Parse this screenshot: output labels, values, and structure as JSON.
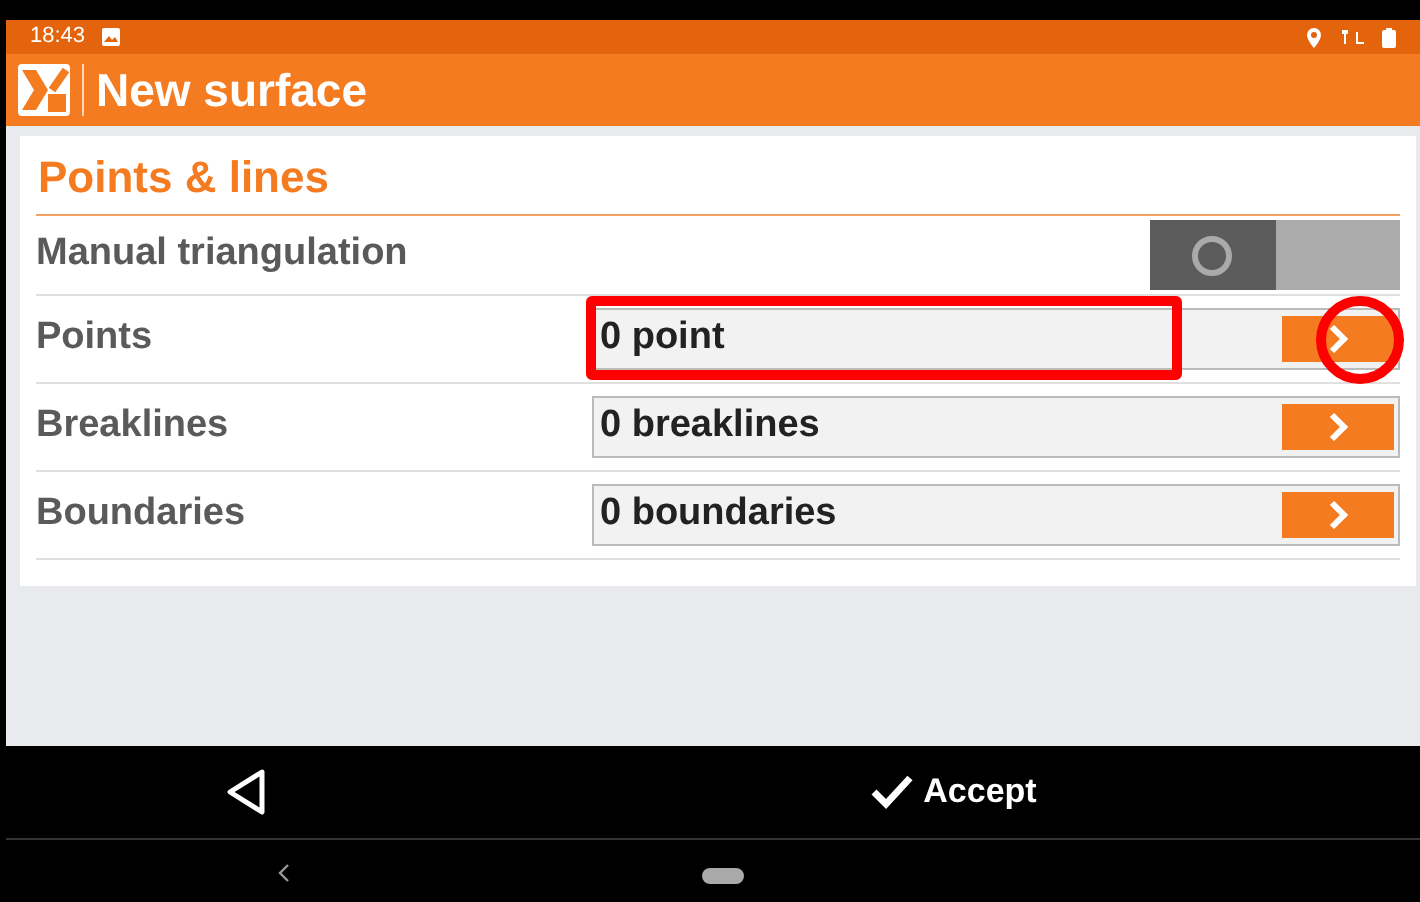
{
  "status_bar": {
    "time": "18:43"
  },
  "app_bar": {
    "title": "New surface"
  },
  "section": {
    "title": "Points & lines"
  },
  "toggle_row": {
    "label": "Manual triangulation",
    "on": false
  },
  "rows": [
    {
      "label": "Points",
      "value": "0 point",
      "highlighted": true
    },
    {
      "label": "Breaklines",
      "value": "0 breaklines",
      "highlighted": false
    },
    {
      "label": "Boundaries",
      "value": "0 boundaries",
      "highlighted": false
    }
  ],
  "bottom_bar": {
    "accept": "Accept"
  }
}
